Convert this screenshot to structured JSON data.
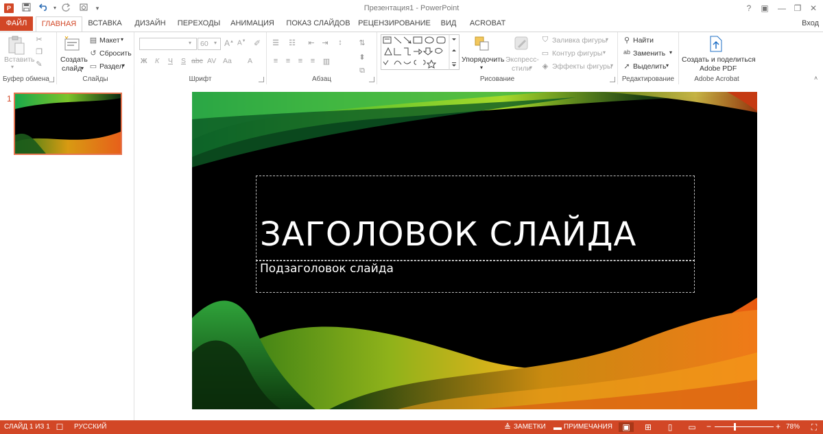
{
  "titlebar": {
    "title": "Презентация1 - PowerPoint",
    "app_icon": "P",
    "qat_icons": [
      "save-icon",
      "undo-icon",
      "redo-icon",
      "touch-mode-icon",
      "customize-icon"
    ],
    "help": "?",
    "ribbon_options": "▣",
    "minimize": "—",
    "restore": "❐",
    "close": "✕"
  },
  "tabs": {
    "file": "ФАЙЛ",
    "home": "ГЛАВНАЯ",
    "insert": "ВСТАВКА",
    "design": "ДИЗАЙН",
    "transitions": "ПЕРЕХОДЫ",
    "animations": "АНИМАЦИЯ",
    "slideshow": "ПОКАЗ СЛАЙДОВ",
    "review": "РЕЦЕНЗИРОВАНИЕ",
    "view": "ВИД",
    "acrobat": "ACROBAT",
    "signin": "Вход"
  },
  "ribbon": {
    "clipboard": {
      "label": "Буфер обмена",
      "paste": "Вставить"
    },
    "slides": {
      "label": "Слайды",
      "new_slide_1": "Создать",
      "new_slide_2": "слайд",
      "layout": "Макет",
      "reset": "Сбросить",
      "section": "Раздел"
    },
    "font": {
      "label": "Шрифт",
      "font_name": "",
      "font_size": "60",
      "bold": "Ж",
      "italic": "К",
      "underline": "Ч",
      "shadow": "S",
      "strike": "abc",
      "spacing": "AV",
      "case": "Aa",
      "color": "A"
    },
    "paragraph": {
      "label": "Абзац"
    },
    "drawing": {
      "label": "Рисование",
      "arrange": "Упорядочить",
      "quick_styles_1": "Экспресс-",
      "quick_styles_2": "стили",
      "fill": "Заливка фигуры",
      "outline": "Контур фигуры",
      "effects": "Эффекты фигуры"
    },
    "editing": {
      "label": "Редактирование",
      "find": "Найти",
      "replace": "Заменить",
      "select": "Выделить"
    },
    "acrobat": {
      "label": "Adobe Acrobat",
      "create_1": "Создать и поделиться",
      "create_2": "Adobe PDF"
    }
  },
  "thumbnails": {
    "slide_number": "1"
  },
  "slide": {
    "title": "ЗАГОЛОВОК СЛАЙДА",
    "subtitle": "Подзаголовок слайда"
  },
  "status": {
    "slide_info": "СЛАЙД 1 ИЗ 1",
    "language": "РУССКИЙ",
    "notes": "ЗАМЕТКИ",
    "comments": "ПРИМЕЧАНИЯ",
    "zoom": "78%",
    "zoom_minus": "−",
    "zoom_plus": "+"
  },
  "colors": {
    "accent": "#d24726",
    "ribbon_bg": "#ffffff",
    "status_bg": "#d24726"
  }
}
